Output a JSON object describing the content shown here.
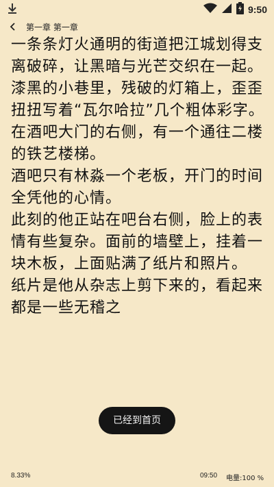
{
  "status_bar": {
    "time": "9:50",
    "icons": [
      "download-icon",
      "wifi-icon",
      "signal-icon",
      "battery-icon"
    ]
  },
  "header": {
    "chapter_title": "第一章 第一章"
  },
  "content": {
    "paragraphs": [
      "一条条灯火通明的街道把江城划得支离破碎，让黑暗与光芒交织在一起。",
      "漆黑的小巷里，残破的灯箱上，歪歪扭扭写着“瓦尔哈拉”几个粗体彩字。",
      "在酒吧大门的右侧，有一个通往二楼的铁艺楼梯。",
      "酒吧只有林淼一个老板，开门的时间全凭他的心情。",
      "此刻的他正站在吧台右侧，脸上的表情有些复杂。面前的墙壁上，挂着一块木板，上面贴满了纸片和照片。",
      "纸片是他从杂志上剪下来的，看起来都是一些无稽之"
    ]
  },
  "toast": {
    "message": "已经到首页"
  },
  "footer": {
    "progress": "8.33%",
    "clock": "09:50",
    "battery": "电量:100 %"
  },
  "colors": {
    "background": "#f6e8c8",
    "text": "#111111",
    "toast_bg": "#151515"
  }
}
